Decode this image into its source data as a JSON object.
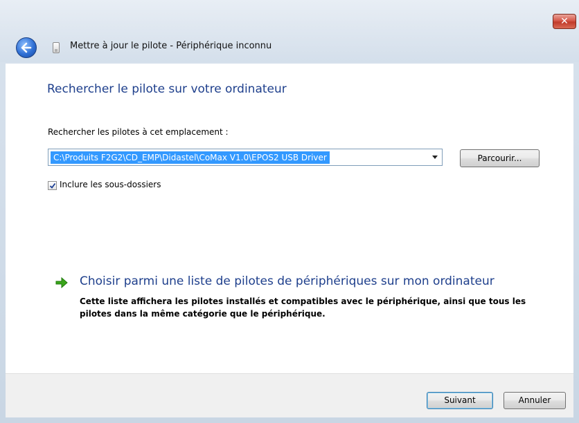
{
  "window": {
    "title": "Mettre à jour le pilote - Périphérique inconnu",
    "close_label": "✕"
  },
  "page": {
    "heading": "Rechercher le pilote sur votre ordinateur",
    "location_label": "Rechercher les pilotes à cet emplacement :",
    "location_value": "C:\\Produits F2G2\\CD_EMP\\Didastel\\CoMax V1.0\\EPOS2 USB Driver",
    "browse_label": "Parcourir...",
    "include_subfolders_label": "Inclure les sous-dossiers",
    "include_subfolders_checked": true,
    "choose_title": "Choisir parmi une liste de pilotes de périphériques sur mon ordinateur",
    "choose_description": "Cette liste affichera les pilotes installés et compatibles avec le périphérique, ainsi que tous les pilotes dans la même catégorie que le périphérique."
  },
  "footer": {
    "next_label": "Suivant",
    "cancel_label": "Annuler"
  },
  "icons": {
    "back": "back-arrow-icon",
    "device": "device-icon",
    "choose": "green-arrow-icon",
    "close": "close-icon"
  },
  "colors": {
    "accent_blue": "#1e3f8c",
    "selection_blue": "#3399ff",
    "close_red": "#c13a2a",
    "arrow_green": "#3aa51a"
  }
}
